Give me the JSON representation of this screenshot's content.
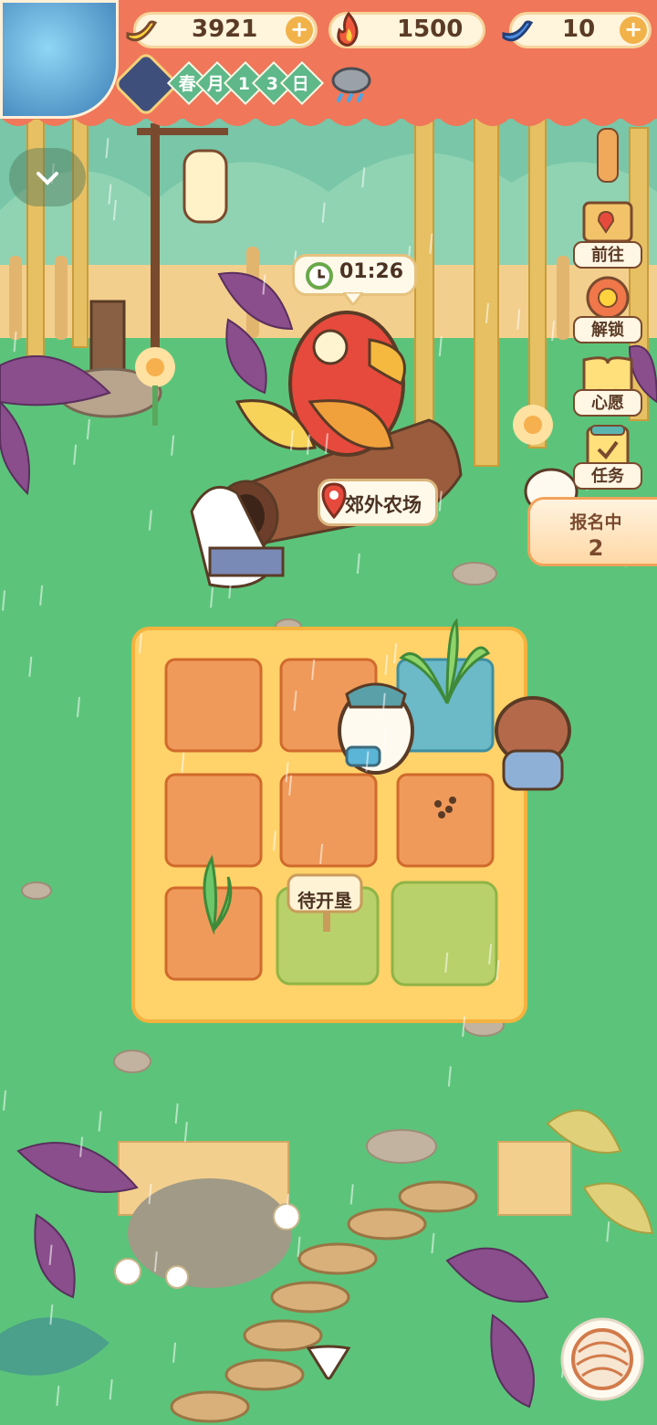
{
  "resources": {
    "banana": {
      "value": "3921",
      "icon": "banana-icon",
      "plus": "+"
    },
    "fire": {
      "value": "1500",
      "icon": "flame-icon"
    },
    "blue_banana": {
      "value": "10",
      "icon": "blue-banana-icon",
      "plus": "+"
    }
  },
  "date": {
    "season": "春",
    "month_char": "月",
    "day_digit1": "1",
    "day_digit2": "3",
    "day_char": "日",
    "weather_icon": "rain-cloud-icon"
  },
  "side_menu": [
    {
      "label": "前往",
      "icon": "signboard-icon"
    },
    {
      "label": "解锁",
      "icon": "unlock-burst-icon"
    },
    {
      "label": "心愿",
      "icon": "wish-book-icon"
    },
    {
      "label": "任务",
      "icon": "task-clipboard-icon"
    }
  ],
  "signup": {
    "label": "报名中",
    "count": "2"
  },
  "timer": {
    "text": "01:26",
    "icon": "clock-icon"
  },
  "location": {
    "text": "郊外农场",
    "icon": "location-pin-icon"
  },
  "farm_sign": {
    "text": "待开垦"
  },
  "colors": {
    "banner": "#f0775a",
    "grass": "#5cc47a",
    "soil": "#ef9a5a",
    "farm_border": "#ffcf66"
  }
}
